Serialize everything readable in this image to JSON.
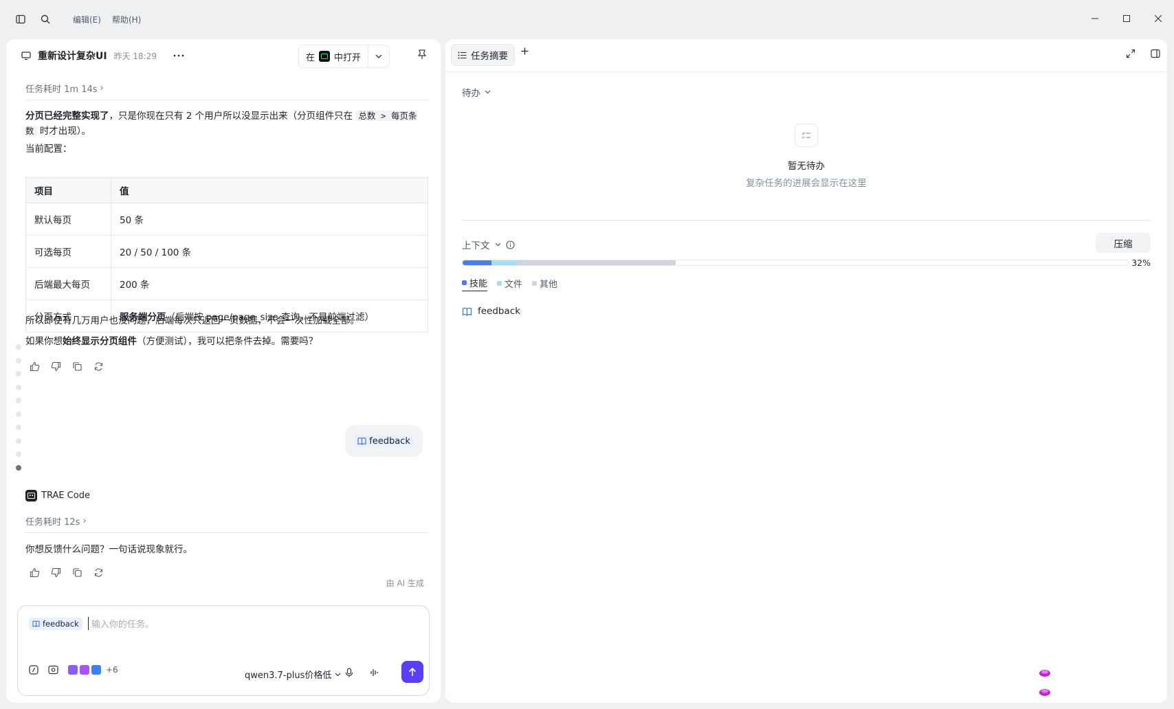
{
  "menu": {
    "edit": "编辑(E)",
    "help": "帮助(H)"
  },
  "left": {
    "title": "重新设计复杂UI",
    "time": "昨天 18:29",
    "open_in": {
      "prefix": "在",
      "suffix": "中打开"
    },
    "task1_time": "任务耗时 1m 14s",
    "para1": {
      "bold": "分页已经完整实现了",
      "text1": "，只是你现在只有 2 个用户所以没显示出来（分页组件只在 ",
      "code": "总数 > 每页条数",
      "text2": " 时才出现）。"
    },
    "current_config": "当前配置：",
    "table": {
      "headers": [
        "项目",
        "值"
      ],
      "rows": [
        {
          "k": "默认每页",
          "v": "50 条"
        },
        {
          "k": "可选每页",
          "v": "20 / 50 / 100 条"
        },
        {
          "k": "后端最大每页",
          "v": "200 条"
        },
        {
          "k": "分页方式",
          "v_bold": "服务端分页",
          "v": "（后端按 page/page_size 查询，不是前端过滤）"
        }
      ]
    },
    "para2": "所以即使有几万用户也没问题，后端每次只返回一页数据，不会一次性加载全部。",
    "para3": {
      "pre": "如果你想",
      "bold": "始终显示分页组件",
      "post": "（方便测试），我可以把条件去掉。需要吗？"
    },
    "user_msg": "feedback",
    "agent_name": "TRAE Code",
    "task2_time": "任务耗时 12s",
    "reply": "你想反馈什么问题？一句话说现象就行。",
    "ai_generated": "由 AI 生成",
    "input": {
      "chip": "feedback",
      "placeholder": "输入你的任务。",
      "more_count": "+6",
      "model": "qwen3.7-plus价格低"
    }
  },
  "right": {
    "tab": "任务摘要",
    "todo_label": "待办",
    "empty_title": "暂无待办",
    "empty_sub": "复杂任务的进展会显示在这里",
    "context_label": "上下文",
    "compress": "压缩",
    "percent": "32%",
    "usage": {
      "skills": 0.043,
      "files": 0.04,
      "other": 0.237
    },
    "legend": [
      "技能",
      "文件",
      "其他"
    ],
    "colors": {
      "skills": "#4a7cf0",
      "files": "#a9dcf5",
      "other": "#d1d5db"
    },
    "skill_item": "feedback"
  }
}
